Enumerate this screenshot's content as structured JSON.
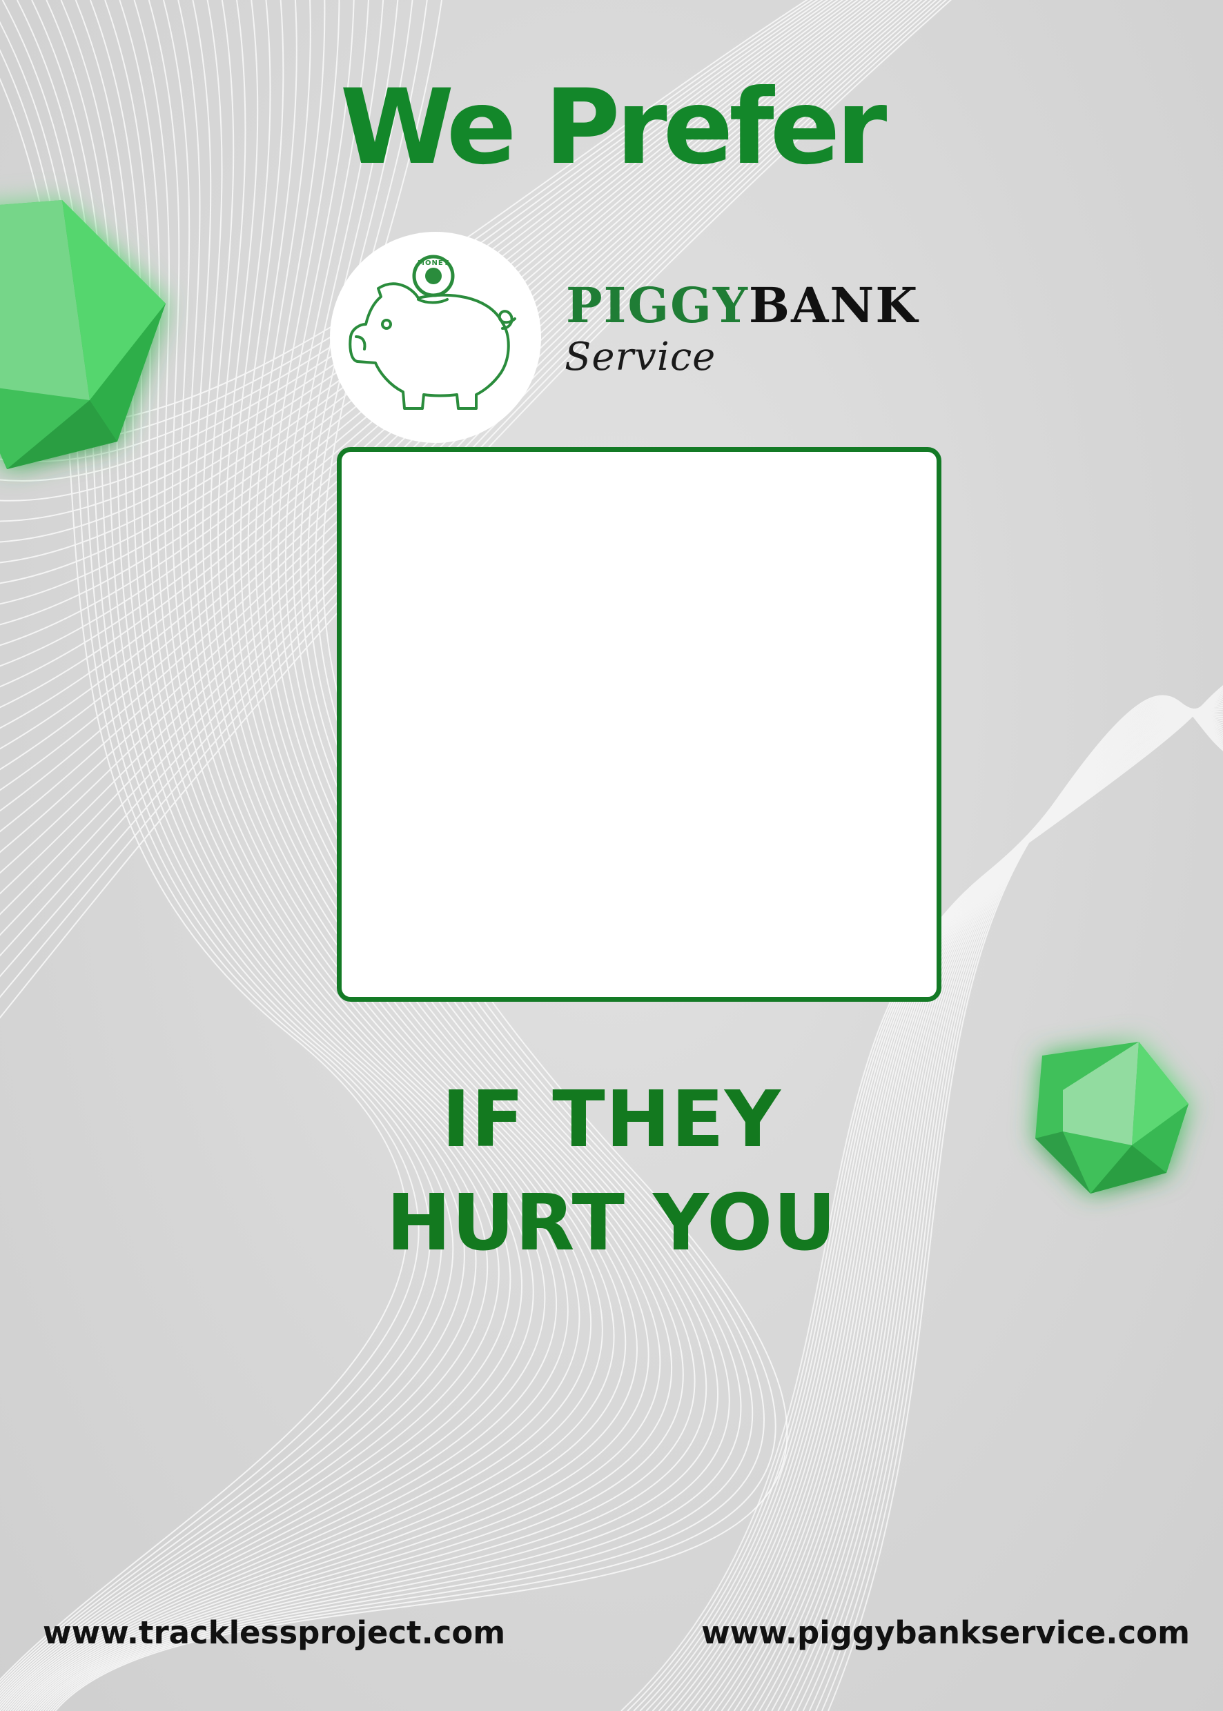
{
  "poster": {
    "headline": "We Prefer",
    "brand": {
      "name_green": "PIGGY",
      "name_dark": "BANK",
      "subtitle": "Service",
      "coin_text": "MONEY"
    },
    "tagline_line1": "IF THEY",
    "tagline_line2": "HURT YOU",
    "footer": {
      "left_url": "www.tracklessproject.com",
      "right_url": "www.piggybankservice.com"
    },
    "colors": {
      "accent_green": "#13872a",
      "frame_green": "#137a25",
      "background": "#d9d9d9",
      "gem_green": "#4fd36a"
    }
  }
}
